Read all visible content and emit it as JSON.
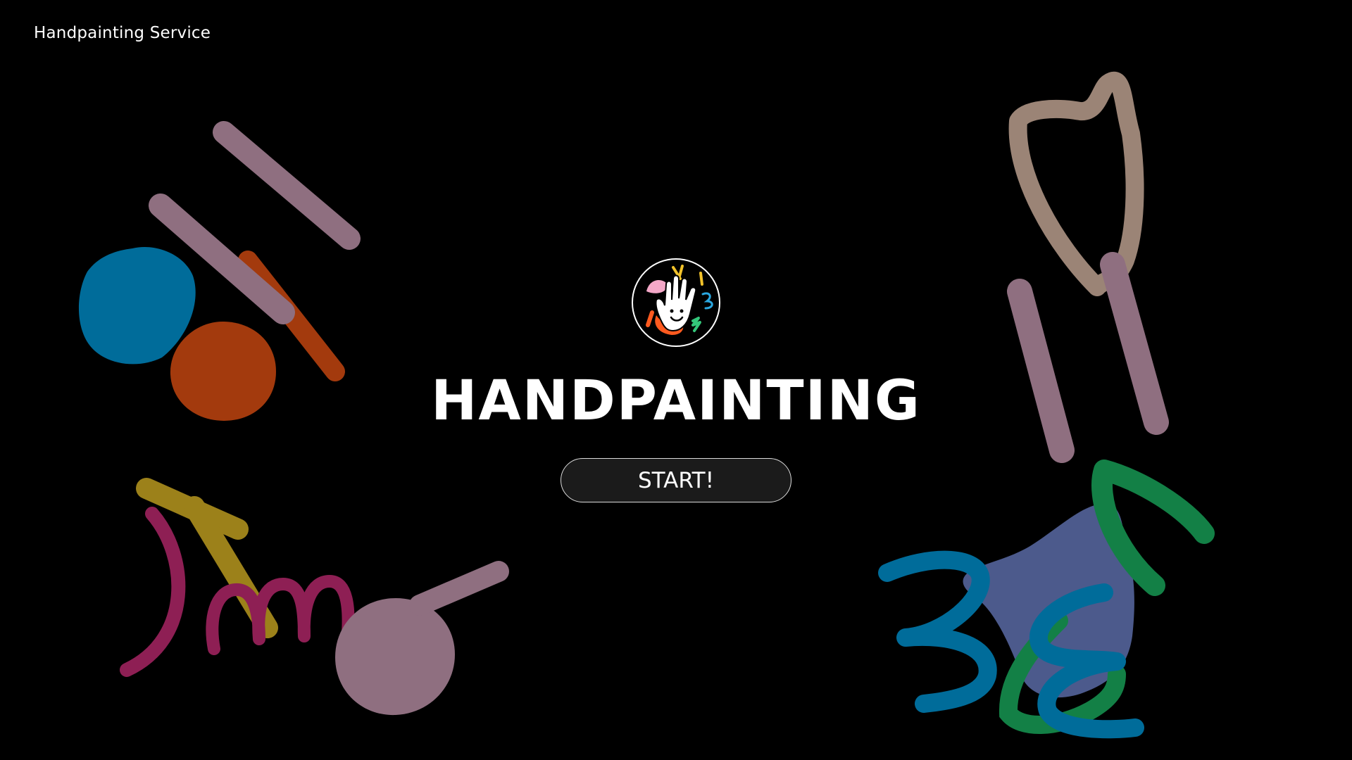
{
  "header": {
    "brand": "Handpainting Service"
  },
  "hero": {
    "title": "HANDPAINTING",
    "start_label": "START!",
    "logo_icon": "waving-hand-icon"
  },
  "colors": {
    "background": "#000000",
    "text": "#ffffff",
    "button_fill": "#1b1b1b",
    "button_border": "#dcdcdc",
    "paint_mauve": "#8f6f80",
    "paint_blue": "#006c9a",
    "paint_orange": "#a33a0d",
    "paint_yellow": "#9c811a",
    "paint_magenta": "#8e1f54",
    "paint_pink": "#8f6f80",
    "paint_taupe": "#9b8476",
    "paint_indigo": "#4c5a8c",
    "paint_green": "#138046"
  }
}
